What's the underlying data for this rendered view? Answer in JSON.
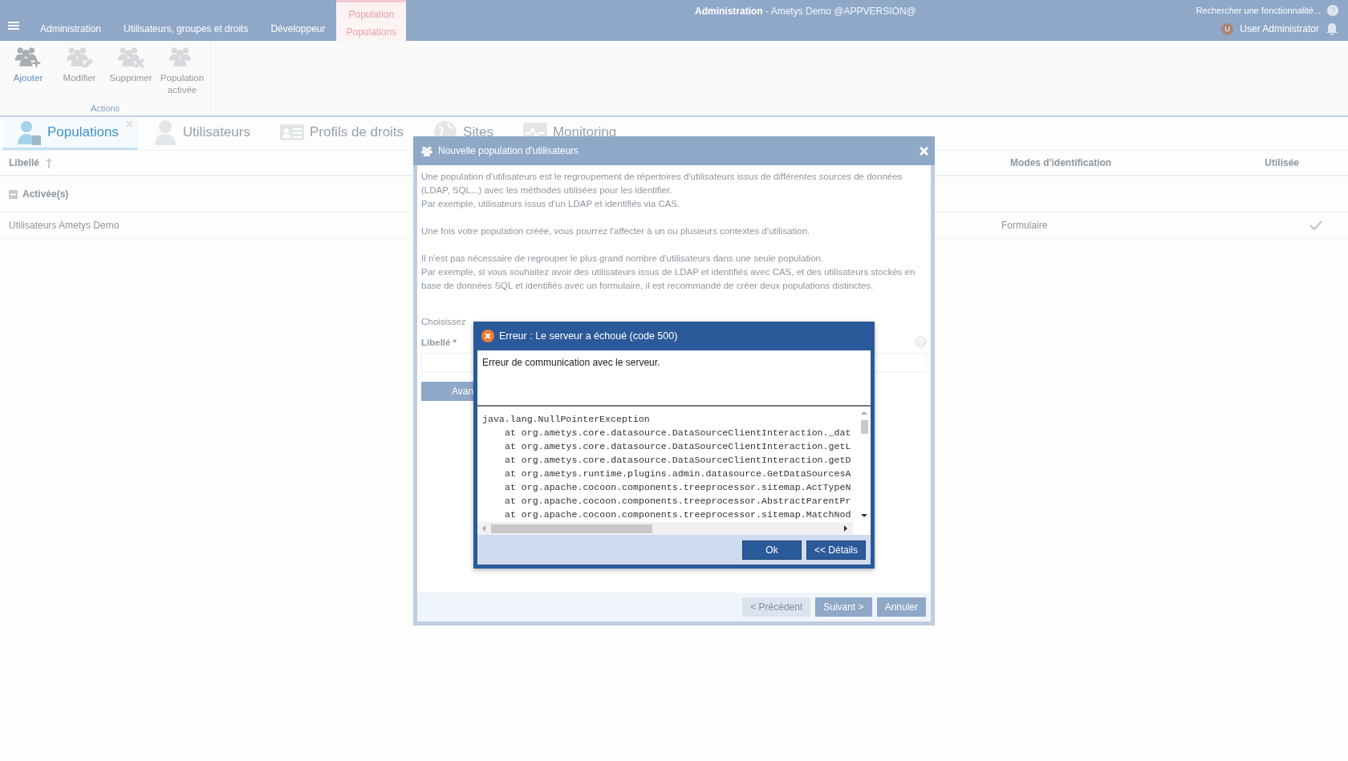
{
  "header": {
    "app_title": "Administration",
    "app_subtitle": "- Ametys Demo @APPVERSION@",
    "search_placeholder": "Rechercher une fonctionnalité...",
    "user": {
      "initial": "U",
      "name": "User Administrator"
    },
    "menu": [
      {
        "label": "Administration",
        "selected": false
      },
      {
        "label": "Utilisateurs, groupes et droits",
        "selected": false
      },
      {
        "label": "Développeur",
        "selected": false
      }
    ],
    "context_group": {
      "label": "Population",
      "tabs": [
        {
          "label": "Populations",
          "selected": true
        }
      ]
    }
  },
  "ribbon": {
    "group_label": "Actions",
    "buttons": [
      {
        "label": "Ajouter",
        "disabled": false,
        "kind": "add"
      },
      {
        "label": "Modifier",
        "disabled": true,
        "kind": "edit"
      },
      {
        "label": "Supprimer",
        "disabled": true,
        "kind": "delete"
      },
      {
        "label": "Population activée",
        "disabled": true,
        "kind": "plain"
      }
    ]
  },
  "tool_tabs": [
    {
      "label": "Populations",
      "selected": true,
      "closable": true,
      "kind": "populations"
    },
    {
      "label": "Utilisateurs",
      "selected": false,
      "closable": false,
      "kind": "user"
    },
    {
      "label": "Profils de droits",
      "selected": false,
      "closable": false,
      "kind": "profile"
    },
    {
      "label": "Sites",
      "selected": false,
      "closable": false,
      "kind": "globe"
    },
    {
      "label": "Monitoring",
      "selected": false,
      "closable": false,
      "kind": "monitor"
    }
  ],
  "table": {
    "columns": [
      "Libellé",
      "Modes d'identification",
      "Utilisée"
    ],
    "groups": [
      {
        "label": "Activée(s)",
        "expanded": true,
        "rows": [
          {
            "label": "Utilisateurs Ametys Demo",
            "modes": "Formulaire",
            "used": true
          }
        ]
      }
    ]
  },
  "wizard": {
    "title": "Nouvelle population d'utilisateurs",
    "paragraphs": [
      [
        "Une population d'utilisateurs est le regroupement de répertoires d'utilisateurs issus de différentes sources de données (LDAP, SQL...) avec les méthodes utilisées pour les identifier.",
        "Par exemple, utilisateurs issus d'un LDAP et identifiés via CAS."
      ],
      [
        "Une fois votre population créée, vous pourrez l'affecter à un ou plusieurs contextes d'utilisation."
      ],
      [
        "Il n'est pas nécessaire de regrouper le plus grand nombre d'utilisateurs dans une seule population.",
        "Par exemple, si vous souhaitez avoir des utilisateurs issus de LDAP et identifiés avec CAS, et des utilisateurs stockés en base de données SQL et identifiés avec un formulaire, il est recommandé de créer deux populations distinctes."
      ]
    ],
    "choose_text": "Choisissez",
    "field_label": "Libellé *",
    "advanced_button": "Avan",
    "buttons": [
      {
        "label": "< Précédent",
        "disabled": true
      },
      {
        "label": "Suivant >",
        "disabled": false
      },
      {
        "label": "Annuler",
        "disabled": false
      }
    ]
  },
  "error": {
    "title": "Erreur : Le serveur a échoué (code 500)",
    "message": "Erreur de communication avec le serveur.",
    "trace": [
      {
        "kind": "exception",
        "text": "java.lang.NullPointerException"
      },
      {
        "kind": "frame",
        "text": "at org.ametys.core.datasource.DataSourceClientInteraction._dat"
      },
      {
        "kind": "frame",
        "text": "at org.ametys.core.datasource.DataSourceClientInteraction.getL"
      },
      {
        "kind": "frame",
        "text": "at org.ametys.core.datasource.DataSourceClientInteraction.getD"
      },
      {
        "kind": "frame",
        "text": "at org.ametys.runtime.plugins.admin.datasource.GetDataSourcesA"
      },
      {
        "kind": "frame",
        "text": "at org.apache.cocoon.components.treeprocessor.sitemap.ActTypeN"
      },
      {
        "kind": "frame",
        "text": "at org.apache.cocoon.components.treeprocessor.AbstractParentPr"
      },
      {
        "kind": "frame",
        "text": "at org.apache.cocoon.components.treeprocessor.sitemap.MatchNod"
      }
    ],
    "buttons": [
      "Ok",
      "<< Détails"
    ]
  }
}
